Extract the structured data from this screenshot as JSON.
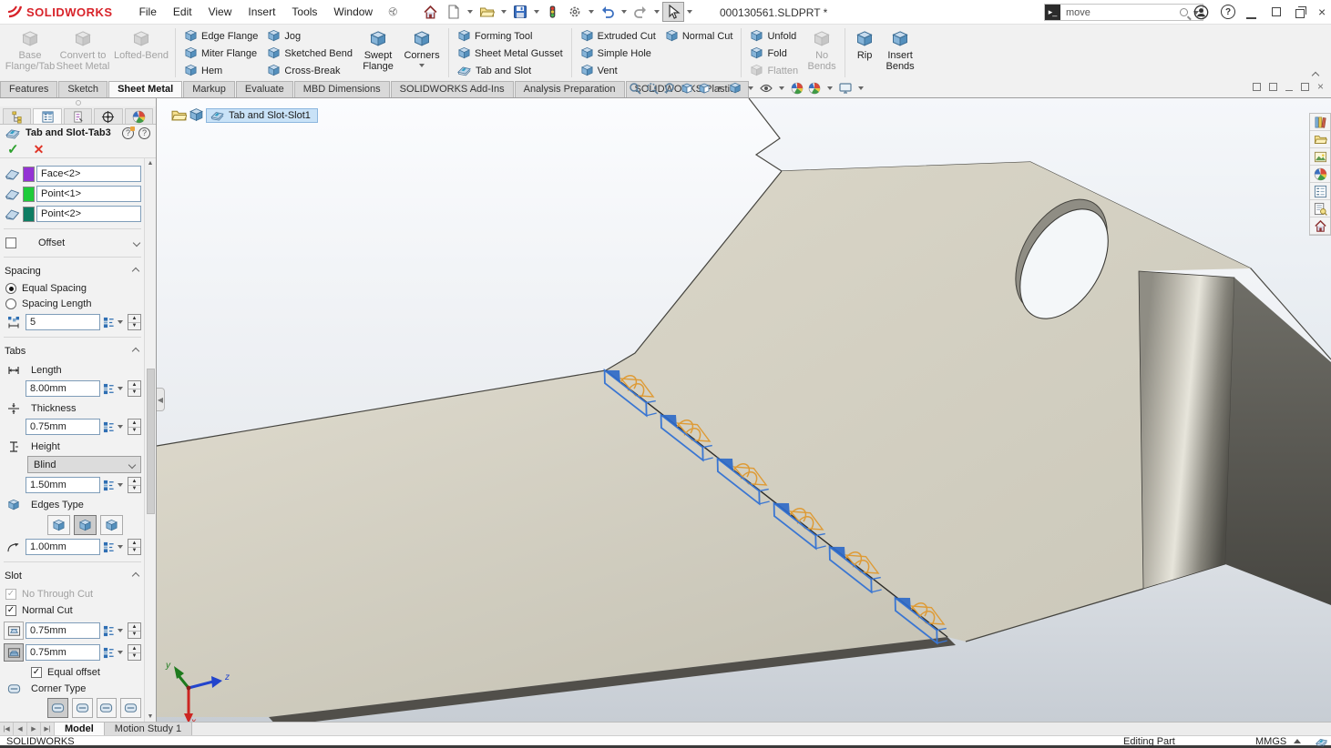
{
  "titlebar": {
    "brand": "SOLIDWORKS",
    "menus": [
      "File",
      "Edit",
      "View",
      "Insert",
      "Tools",
      "Window"
    ],
    "document_title": "000130561.SLDPRT *",
    "search_value": "move"
  },
  "ribbon": {
    "base_flange": "Base Flange/Tab",
    "convert": "Convert to Sheet Metal",
    "lofted": "Lofted-Bend",
    "edge_flange": "Edge Flange",
    "miter_flange": "Miter Flange",
    "hem": "Hem",
    "jog": "Jog",
    "sketched_bend": "Sketched Bend",
    "cross_break": "Cross-Break",
    "swept_flange": "Swept Flange",
    "corners": "Corners",
    "forming_tool": "Forming Tool",
    "gusset": "Sheet Metal Gusset",
    "tab_and_slot": "Tab and Slot",
    "extruded_cut": "Extruded Cut",
    "simple_hole": "Simple Hole",
    "vent": "Vent",
    "normal_cut": "Normal Cut",
    "unfold": "Unfold",
    "fold": "Fold",
    "flatten": "Flatten",
    "no_bends": "No Bends",
    "rip": "Rip",
    "insert_bends": "Insert Bends"
  },
  "tabs": {
    "items": [
      "Features",
      "Sketch",
      "Sheet Metal",
      "Markup",
      "Evaluate",
      "MBD Dimensions",
      "SOLIDWORKS Add-Ins",
      "Analysis Preparation",
      "SOLIDWORKS Plastics"
    ],
    "active": "Sheet Metal"
  },
  "pm": {
    "title": "Tab and Slot-Tab3",
    "sel_face": "Face<2>",
    "sel_point1": "Point<1>",
    "sel_point2": "Point<2>",
    "colors": {
      "face": "#9333d4",
      "point1": "#1ecb3a",
      "point2": "#0e7d63"
    },
    "offset": "Offset",
    "spacing_header": "Spacing",
    "equal_spacing": "Equal Spacing",
    "spacing_length": "Spacing Length",
    "instances": "5",
    "tabs_header": "Tabs",
    "length_label": "Length",
    "length_value": "8.00mm",
    "thickness_label": "Thickness",
    "thickness_value": "0.75mm",
    "height_label": "Height",
    "height_type": "Blind",
    "height_value": "1.50mm",
    "edges_label": "Edges Type",
    "fillet_value": "1.00mm",
    "slot_header": "Slot",
    "no_through": "No Through Cut",
    "normal_cut": "Normal Cut",
    "slot_offset1": "0.75mm",
    "slot_offset2": "0.75mm",
    "equal_offset": "Equal offset",
    "corner_label": "Corner Type"
  },
  "breadcrumb": {
    "label": "Tab and Slot-Slot1"
  },
  "viewport": {
    "triad": {
      "x": "x",
      "y": "y",
      "z": "z"
    }
  },
  "bottom": {
    "model_tab": "Model",
    "motion_tab": "Motion Study 1"
  },
  "status": {
    "brand": "SOLIDWORKS",
    "mode": "Editing Part",
    "units": "MMGS"
  }
}
